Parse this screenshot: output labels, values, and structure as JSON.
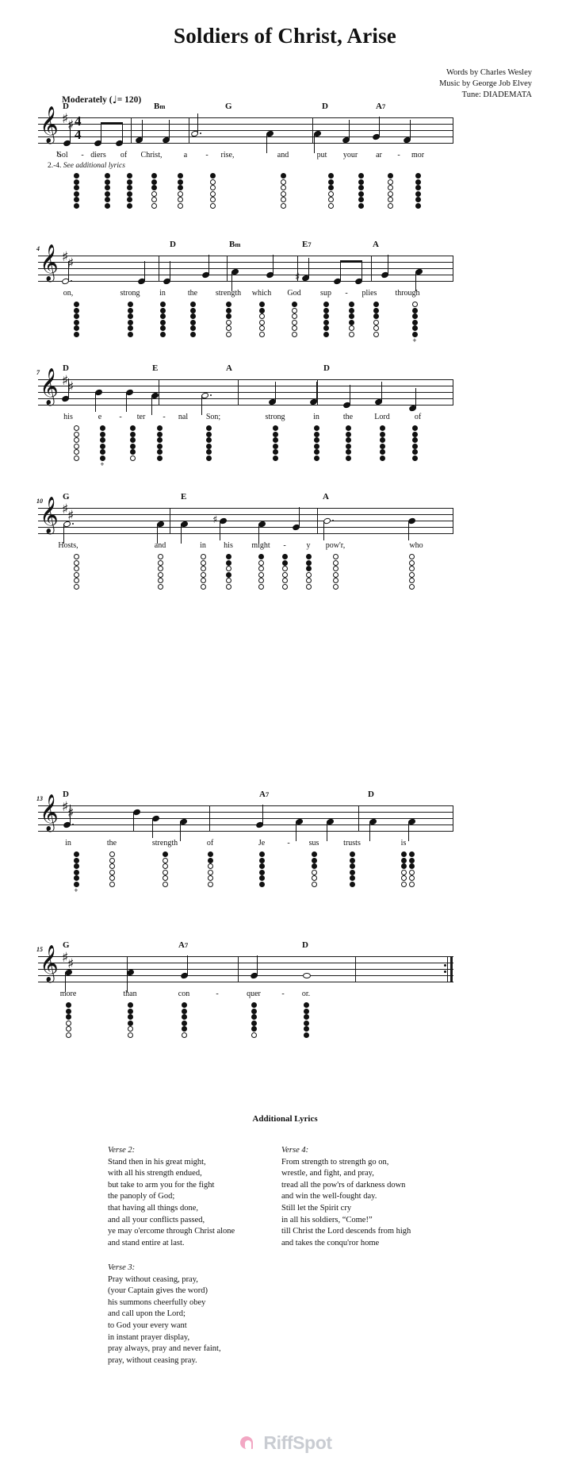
{
  "document": {
    "title": "Soldiers of Christ, Arise",
    "credits": [
      "Words by Charles Wesley",
      "Music by George Job Elvey",
      "Tune: DIADEMATA"
    ],
    "tempo_text": "Moderately",
    "tempo_bpm": "= 120",
    "key_signature": "2 sharps (D major)",
    "time_signature": {
      "top": "4",
      "bottom": "4"
    },
    "clef": "treble"
  },
  "systems": [
    {
      "measure_number": "",
      "chords": [
        "D",
        "Bm",
        "G",
        "D",
        "A7"
      ],
      "lyrics_prefix": "1.",
      "lyrics": [
        "Sol",
        "-",
        "diers",
        "of",
        "Christ,",
        "a",
        "-",
        "rise,",
        "and",
        "put",
        "your",
        "ar",
        "-",
        "mor"
      ],
      "alt_verse_note_num": "2.-4.",
      "alt_verse_note": "See additional lyrics"
    },
    {
      "measure_number": "4",
      "chords": [
        "D",
        "Bm",
        "E7",
        "A"
      ],
      "lyrics": [
        "on,",
        "strong",
        "in",
        "the",
        "strength",
        "which",
        "God",
        "sup",
        "-",
        "plies",
        "through"
      ]
    },
    {
      "measure_number": "7",
      "chords": [
        "D",
        "E",
        "A",
        "D"
      ],
      "lyrics": [
        "his",
        "e",
        "-",
        "ter",
        "-",
        "nal",
        "Son;",
        "strong",
        "in",
        "the",
        "Lord",
        "of"
      ]
    },
    {
      "measure_number": "10",
      "chords": [
        "G",
        "E",
        "A"
      ],
      "lyrics": [
        "Hosts,",
        "and",
        "in",
        "his",
        "might",
        "-",
        "y",
        "pow'r,",
        "who"
      ]
    },
    {
      "measure_number": "13",
      "chords": [
        "D",
        "A7",
        "D"
      ],
      "lyrics": [
        "in",
        "the",
        "strength",
        "of",
        "Je",
        "-",
        "sus",
        "trusts",
        "is"
      ]
    },
    {
      "measure_number": "15",
      "chords": [
        "G",
        "A7",
        "D"
      ],
      "lyrics": [
        "more",
        "than",
        "con",
        "-",
        "quer",
        "-",
        "or."
      ]
    }
  ],
  "additional_lyrics": {
    "heading": "Additional Lyrics",
    "columns": [
      {
        "verses": [
          {
            "label": "Verse 2:",
            "lines": [
              "Stand then in his great might,",
              "with all his strength endued,",
              "but take to arm you for the fight",
              "the panoply of God;",
              "that having all things done,",
              "and all your conflicts passed,",
              "ye may o'ercome through Christ alone",
              "and stand entire at last."
            ]
          },
          {
            "label": "Verse 3:",
            "lines": [
              "Pray without ceasing, pray,",
              "(your Captain gives the word)",
              "his summons cheerfully obey",
              "and call upon the Lord;",
              "to God your every want",
              "in instant prayer display,",
              "pray always, pray and never faint,",
              "pray, without ceasing pray."
            ]
          }
        ]
      },
      {
        "verses": [
          {
            "label": "Verse 4:",
            "lines": [
              "From strength to strength go on,",
              "wrestle, and fight, and pray,",
              "tread all the pow'rs of darkness down",
              "and win the well-fought day.",
              "Still let the Spirit cry",
              "in all his soldiers, “Come!”",
              "till Christ the Lord descends from high",
              "and takes the conqu'ror home"
            ]
          }
        ]
      }
    ]
  },
  "footer": {
    "brand": "RiffSpot",
    "brand_color": "#c9ccd2",
    "mark_color": "#f2a7c3"
  },
  "colors": {
    "ink": "#111111",
    "paper": "#ffffff"
  }
}
